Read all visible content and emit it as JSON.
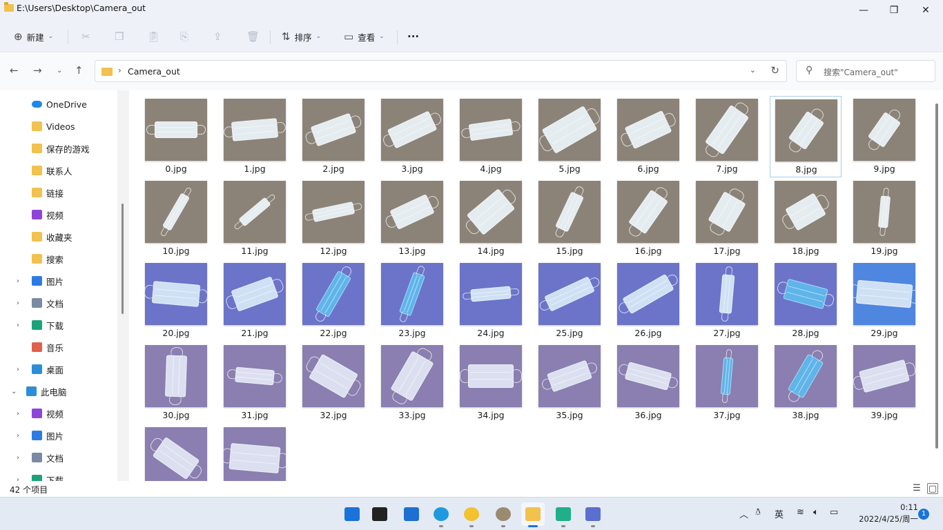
{
  "window": {
    "title": "E:\\Users\\Desktop\\Camera_out",
    "controls": {
      "minimize": "—",
      "maximize": "❐",
      "close": "✕"
    }
  },
  "toolbar": {
    "new_label": "新建",
    "sort_label": "排序",
    "view_label": "查看",
    "more_label": "···"
  },
  "address": {
    "crumb": "Camera_out",
    "search_placeholder": "搜索\"Camera_out\""
  },
  "sidebar": {
    "items": [
      {
        "label": "OneDrive",
        "icon": "cloud-icon",
        "color": "#1e88e5",
        "expandable": false,
        "indent": 1
      },
      {
        "label": "Videos",
        "icon": "folder-icon",
        "color": "#f2c14e",
        "expandable": false,
        "indent": 1
      },
      {
        "label": "保存的游戏",
        "icon": "folder-icon",
        "color": "#f2c14e",
        "expandable": false,
        "indent": 1
      },
      {
        "label": "联系人",
        "icon": "folder-icon",
        "color": "#f2c14e",
        "expandable": false,
        "indent": 1
      },
      {
        "label": "链接",
        "icon": "folder-icon",
        "color": "#f2c14e",
        "expandable": false,
        "indent": 1
      },
      {
        "label": "视频",
        "icon": "video-icon",
        "color": "#8e44d8",
        "expandable": false,
        "indent": 1
      },
      {
        "label": "收藏夹",
        "icon": "folder-icon",
        "color": "#f2c14e",
        "expandable": false,
        "indent": 1
      },
      {
        "label": "搜索",
        "icon": "folder-icon",
        "color": "#f2c14e",
        "expandable": false,
        "indent": 1
      },
      {
        "label": "图片",
        "icon": "picture-icon",
        "color": "#2c7be5",
        "expandable": true,
        "indent": 1
      },
      {
        "label": "文档",
        "icon": "document-icon",
        "color": "#7a8aa3",
        "expandable": true,
        "indent": 1
      },
      {
        "label": "下载",
        "icon": "download-icon",
        "color": "#1aa37a",
        "expandable": true,
        "indent": 1
      },
      {
        "label": "音乐",
        "icon": "music-icon",
        "color": "#e0604a",
        "expandable": false,
        "indent": 1
      },
      {
        "label": "桌面",
        "icon": "desktop-icon",
        "color": "#2a8fd8",
        "expandable": true,
        "indent": 1
      },
      {
        "label": "此电脑",
        "icon": "computer-icon",
        "color": "#2a8fd8",
        "expandable": true,
        "expanded": true,
        "indent": 0
      },
      {
        "label": "视频",
        "icon": "video-icon",
        "color": "#8e44d8",
        "expandable": true,
        "indent": 1
      },
      {
        "label": "图片",
        "icon": "picture-icon",
        "color": "#2c7be5",
        "expandable": true,
        "indent": 1
      },
      {
        "label": "文档",
        "icon": "document-icon",
        "color": "#7a8aa3",
        "expandable": true,
        "indent": 1
      },
      {
        "label": "下载",
        "icon": "download-icon",
        "color": "#1aa37a",
        "expandable": true,
        "indent": 1
      }
    ]
  },
  "files": [
    "0.jpg",
    "1.jpg",
    "2.jpg",
    "3.jpg",
    "4.jpg",
    "5.jpg",
    "6.jpg",
    "7.jpg",
    "8.jpg",
    "9.jpg",
    "10.jpg",
    "11.jpg",
    "12.jpg",
    "13.jpg",
    "14.jpg",
    "15.jpg",
    "16.jpg",
    "17.jpg",
    "18.jpg",
    "19.jpg",
    "20.jpg",
    "21.jpg",
    "22.jpg",
    "23.jpg",
    "24.jpg",
    "25.jpg",
    "26.jpg",
    "27.jpg",
    "28.jpg",
    "29.jpg",
    "30.jpg",
    "31.jpg",
    "32.jpg",
    "33.jpg",
    "34.jpg",
    "35.jpg",
    "36.jpg",
    "37.jpg",
    "38.jpg",
    "39.jpg",
    "",
    ""
  ],
  "selected_index": 8,
  "thumb_colors": {
    "gray_bg": "#8c8378",
    "blue_bg": "#6c74c9",
    "purple_bg": "#8a7fb0",
    "white_mask": "#e4ecef",
    "blue_mask": "#5fb4ea"
  },
  "status": {
    "count": "42 个项目"
  },
  "taskbar": {
    "apps": [
      "start-icon",
      "task-view-icon",
      "widgets-icon",
      "edge-icon",
      "music-app-icon",
      "avatar-app-icon",
      "file-explorer-icon",
      "notes-app-icon",
      "r-app-icon"
    ],
    "tray": {
      "ime": "英"
    },
    "clock": {
      "time": "0:11",
      "date": "2022/4/25/周一"
    },
    "notification_count": "1"
  }
}
